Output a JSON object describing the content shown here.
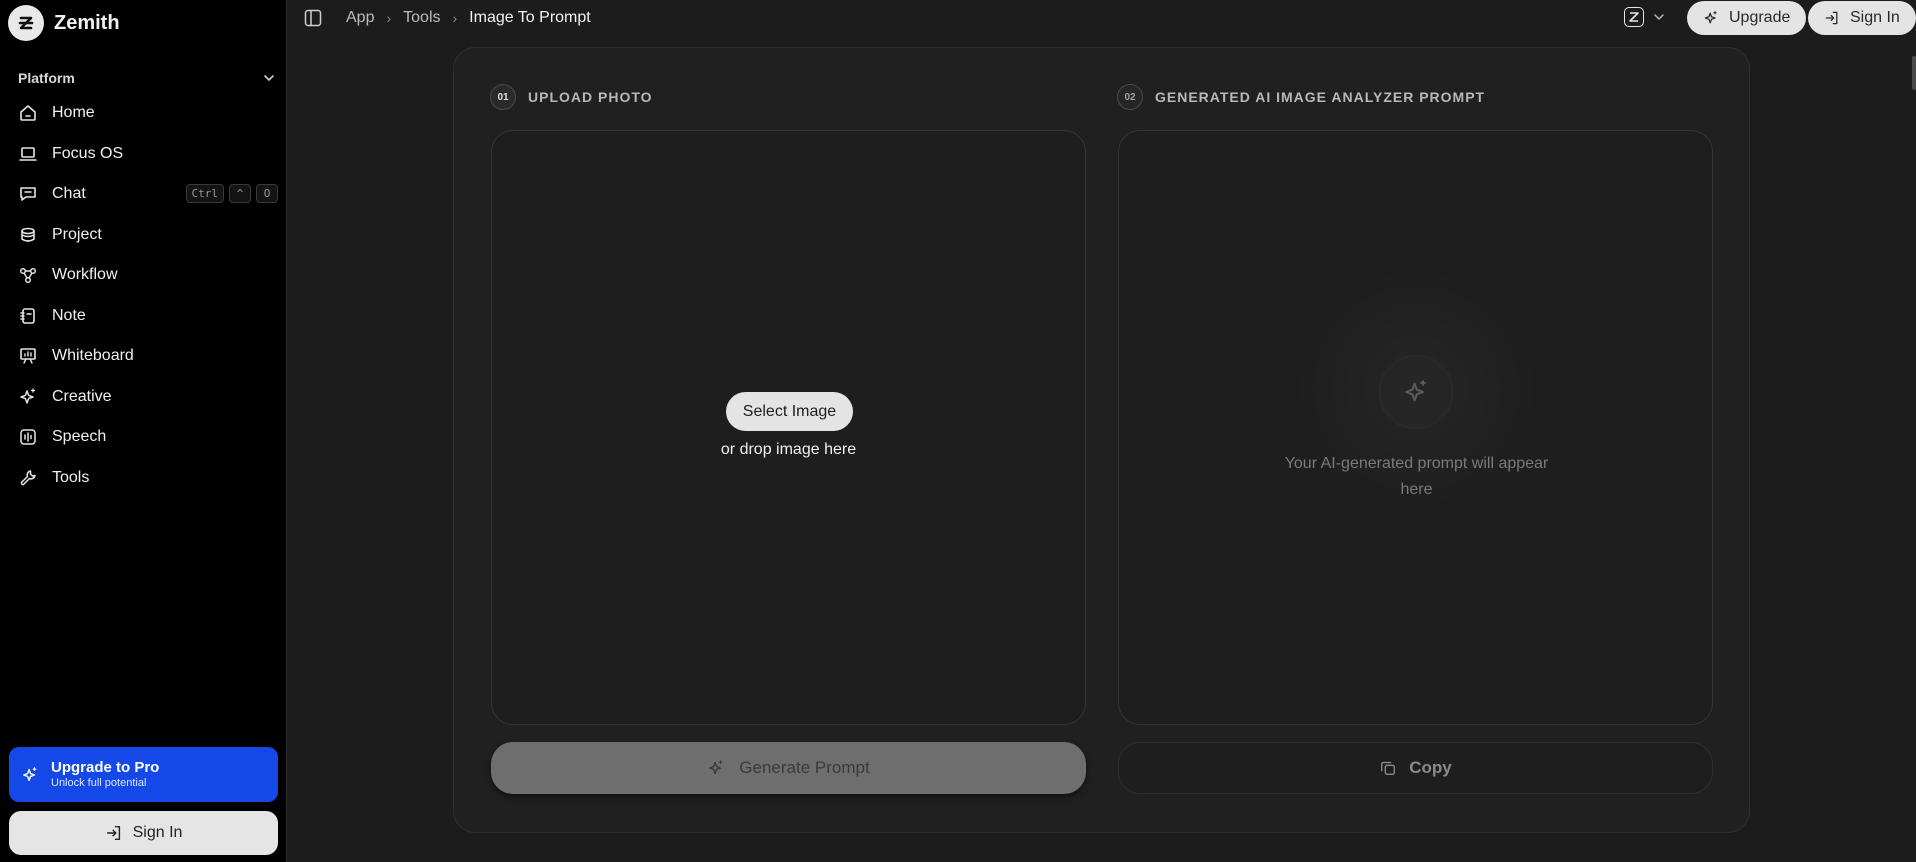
{
  "brand": {
    "name": "Zemith"
  },
  "sidebar": {
    "section_label": "Platform",
    "items": [
      {
        "label": "Home",
        "icon": "home-icon"
      },
      {
        "label": "Focus OS",
        "icon": "laptop-icon"
      },
      {
        "label": "Chat",
        "icon": "chat-icon",
        "shortcut": [
          "Ctrl",
          "^",
          "O"
        ]
      },
      {
        "label": "Project",
        "icon": "project-icon"
      },
      {
        "label": "Workflow",
        "icon": "workflow-icon"
      },
      {
        "label": "Note",
        "icon": "note-icon"
      },
      {
        "label": "Whiteboard",
        "icon": "whiteboard-icon"
      },
      {
        "label": "Creative",
        "icon": "sparkles-icon"
      },
      {
        "label": "Speech",
        "icon": "audio-wave-icon"
      },
      {
        "label": "Tools",
        "icon": "wrench-icon"
      }
    ],
    "upgrade": {
      "title": "Upgrade to Pro",
      "subtitle": "Unlock full potential"
    },
    "signin_label": "Sign In"
  },
  "topbar": {
    "breadcrumbs": [
      "App",
      "Tools",
      "Image To Prompt"
    ],
    "upgrade_label": "Upgrade",
    "signin_label": "Sign In"
  },
  "main": {
    "upload": {
      "step": "01",
      "label": "UPLOAD PHOTO",
      "select_button": "Select Image",
      "drop_hint": "or drop image here"
    },
    "output": {
      "step": "02",
      "label": "GENERATED AI IMAGE ANALYZER PROMPT",
      "placeholder": "Your AI-generated prompt will appear here"
    },
    "generate_button": "Generate Prompt",
    "copy_button": "Copy"
  },
  "colors": {
    "background": "#1c1c1c",
    "sidebar": "#000000",
    "accent_blue": "#1448e8",
    "button_light": "#e4e4e4",
    "button_disabled": "#6e6e6e"
  }
}
